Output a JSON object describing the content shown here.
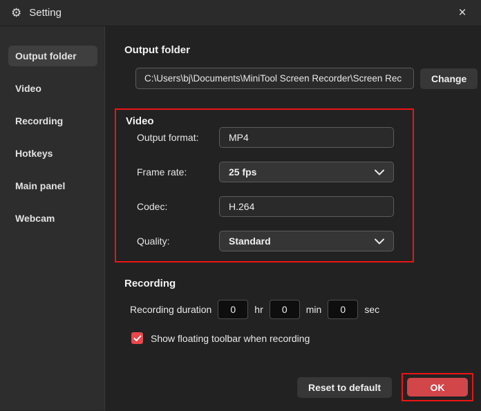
{
  "window": {
    "title": "Setting"
  },
  "sidebar": {
    "items": [
      {
        "label": "Output folder",
        "selected": true
      },
      {
        "label": "Video",
        "selected": false
      },
      {
        "label": "Recording",
        "selected": false
      },
      {
        "label": "Hotkeys",
        "selected": false
      },
      {
        "label": "Main panel",
        "selected": false
      },
      {
        "label": "Webcam",
        "selected": false
      }
    ]
  },
  "output_folder": {
    "heading": "Output folder",
    "path": "C:\\Users\\bj\\Documents\\MiniTool Screen Recorder\\Screen Rec",
    "change_label": "Change"
  },
  "video": {
    "heading": "Video",
    "output_format": {
      "label": "Output format:",
      "value": "MP4"
    },
    "frame_rate": {
      "label": "Frame rate:",
      "value": "25 fps"
    },
    "codec": {
      "label": "Codec:",
      "value": "H.264"
    },
    "quality": {
      "label": "Quality:",
      "value": "Standard"
    }
  },
  "recording": {
    "heading": "Recording",
    "duration_label": "Recording duration",
    "hours": "0",
    "hr_label": "hr",
    "minutes": "0",
    "min_label": "min",
    "seconds": "0",
    "sec_label": "sec",
    "floating_toolbar": {
      "checked": true,
      "label": "Show floating toolbar when recording"
    }
  },
  "footer": {
    "reset_label": "Reset to default",
    "ok_label": "OK"
  },
  "colors": {
    "annotation_red": "#ee1414",
    "ok_button_red": "#d24548",
    "checkbox_red": "#e8474b",
    "background": "#222222",
    "sidebar_background": "#2d2d2d",
    "titlebar_background": "#2b2b2b"
  }
}
